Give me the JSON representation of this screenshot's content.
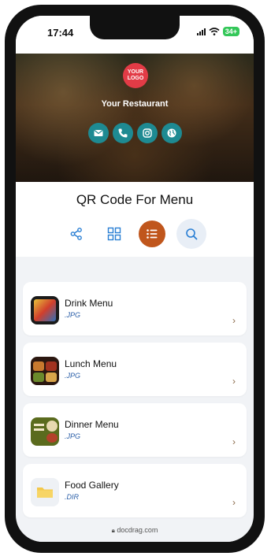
{
  "status": {
    "time": "17:44",
    "battery": "34+"
  },
  "hero": {
    "logo_line1": "YOUR",
    "logo_line2": "LOGO",
    "restaurant_name": "Your Restaurant",
    "socials": [
      "mail-icon",
      "phone-icon",
      "instagram-icon",
      "globe-icon"
    ],
    "accent": "#1e8a92"
  },
  "page": {
    "title": "QR Code For Menu",
    "actions": [
      "share-icon",
      "grid-view-icon",
      "list-view-icon",
      "search-icon"
    ],
    "active_color": "#c0561c"
  },
  "items": [
    {
      "name": "Drink Menu",
      "ext": ".JPG"
    },
    {
      "name": "Lunch Menu",
      "ext": ".JPG"
    },
    {
      "name": "Dinner Menu",
      "ext": ".JPG"
    },
    {
      "name": "Food Gallery",
      "ext": ".DIR"
    }
  ],
  "browser": {
    "url": "docdrag.com"
  }
}
